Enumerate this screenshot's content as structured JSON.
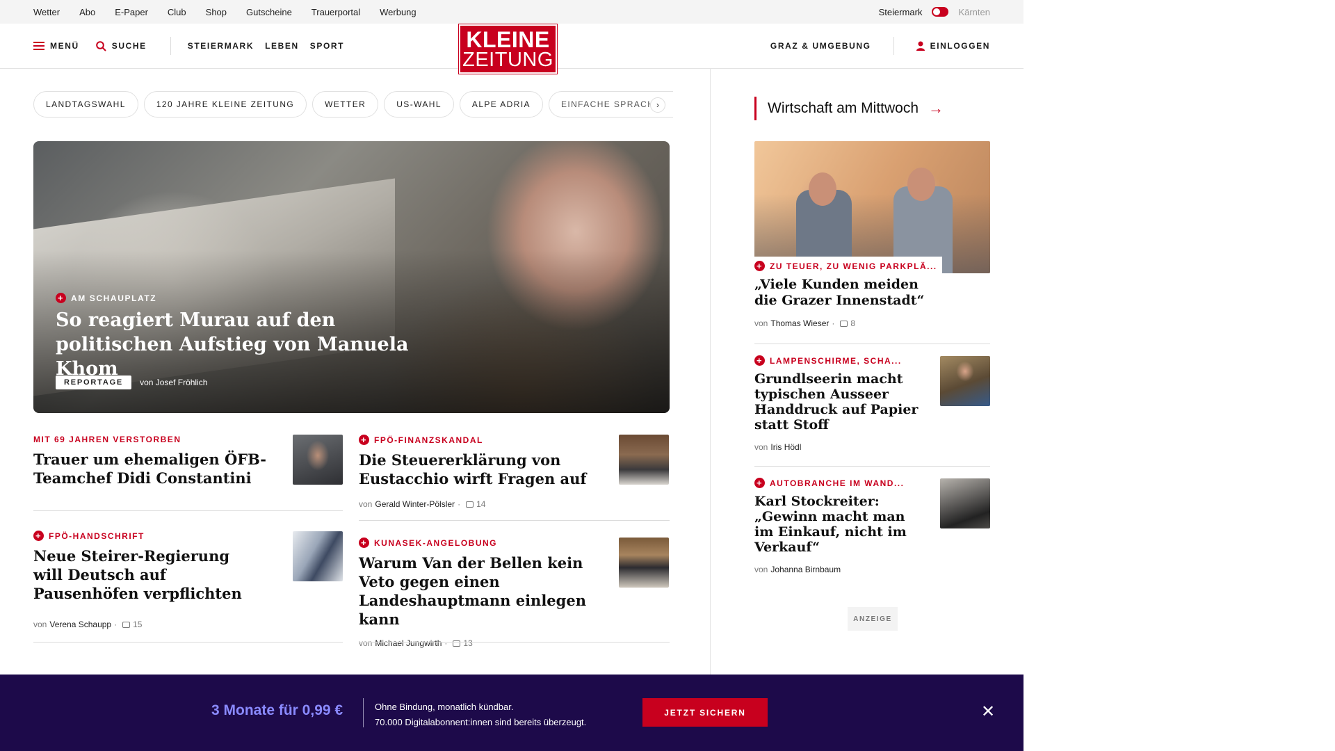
{
  "utility": {
    "links": [
      "Wetter",
      "Abo",
      "E-Paper",
      "Club",
      "Shop",
      "Gutscheine",
      "Trauerportal",
      "Werbung"
    ],
    "region_active": "Steiermark",
    "region_inactive": "Kärnten"
  },
  "header": {
    "menu_label": "MENÜ",
    "search_label": "SUCHE",
    "nav": [
      "STEIERMARK",
      "LEBEN",
      "SPORT"
    ],
    "logo_line1": "KLEINE",
    "logo_line2": "ZEITUNG",
    "local_label": "GRAZ & UMGEBUNG",
    "login_label": "EINLOGGEN"
  },
  "topics": [
    "LANDTAGSWAHL",
    "120 JAHRE KLEINE ZEITUNG",
    "WETTER",
    "US-WAHL",
    "ALPE ADRIA",
    "EINFACHE SPRACHE"
  ],
  "hero": {
    "kicker": "AM SCHAUPLATZ",
    "title": "So reagiert Murau auf den politischen Aufstieg von Manuela Khom",
    "badge": "REPORTAGE",
    "byline": "von Josef Fröhlich"
  },
  "teasers": [
    {
      "kicker": "MIT 69 JAHREN VERSTORBEN",
      "title": "Trauer um ehemaligen ÖFB-Teamchef Didi Constantini",
      "plus": false
    },
    {
      "kicker": "FPÖ-FINANZSKANDAL",
      "title": "Die Steuererklärung von Eustacchio wirft Fragen auf",
      "by": "von",
      "author": "Gerald Winter-Pölsler",
      "comments": "14",
      "plus": true
    },
    {
      "kicker": "FPÖ-HANDSCHRIFT",
      "title": "Neue Steirer-Regierung will Deutsch auf Pausenhöfen verpflichten",
      "by": "von",
      "author": "Verena Schaupp",
      "comments": "15",
      "plus": true
    },
    {
      "kicker": "KUNASEK-ANGELOBUNG",
      "title": "Warum Van der Bellen kein Veto gegen einen Landeshauptmann einlegen kann",
      "by": "von",
      "author": "Michael Jungwirth",
      "comments": "13",
      "plus": true
    }
  ],
  "sidebar": {
    "heading": "Wirtschaft am Mittwoch",
    "items": [
      {
        "kicker": "ZU TEUER, ZU WENIG PARKPLÄ...",
        "title": "„Viele Kunden meiden die Grazer Innenstadt“",
        "by": "von",
        "author": "Thomas Wieser",
        "comments": "8"
      },
      {
        "kicker": "LAMPENSCHIRME, SCHA...",
        "title": "Grundlseerin macht typischen Ausseer Handdruck auf Papier statt Stoff",
        "by": "von",
        "author": "Iris Hödl"
      },
      {
        "kicker": "AUTOBRANCHE IM WAND...",
        "title": "Karl Stockreiter: „Gewinn macht man im Einkauf, nicht im Verkauf“",
        "by": "von",
        "author": "Johanna Birnbaum"
      }
    ],
    "ad_label": "ANZEIGE"
  },
  "promo": {
    "price": "3 Monate für 0,99 €",
    "line1": "Ohne Bindung, monatlich kündbar.",
    "line2": "70.000 Digitalabonnent:innen sind bereits überzeugt.",
    "cta": "JETZT SICHERN"
  },
  "colors": {
    "brand_red": "#c8001e",
    "banner_bg": "#1d0a4a",
    "price_blue": "#8a8aff"
  }
}
